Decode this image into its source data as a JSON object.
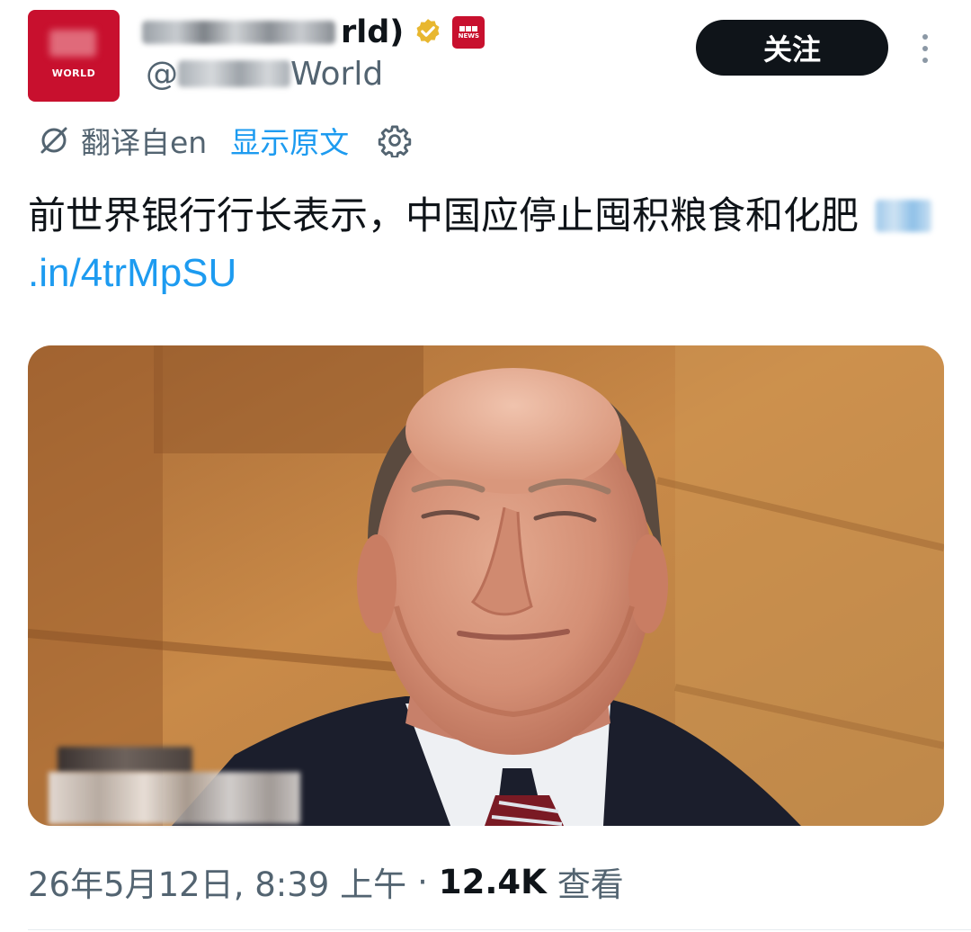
{
  "account": {
    "display_name": "rld)",
    "handle": "@",
    "handle_suffix": "World",
    "avatar_label": "WORLD",
    "affiliate_badge": "NEWS",
    "verified": true
  },
  "header": {
    "follow_label": "关注"
  },
  "translation": {
    "label": "翻译自en",
    "show_original_label": "显示原文"
  },
  "tweet": {
    "text": "前世界银行行长表示，中国应停止囤积粮食和化肥",
    "link_text": ".in/4trMpSU"
  },
  "media": {
    "alt": "news-photo"
  },
  "meta": {
    "timestamp": "26年5月12日, 8:39 上午",
    "separator": "·",
    "views_count": "12.4K",
    "views_label": "查看"
  },
  "colors": {
    "brand_red": "#c8102e",
    "link_blue": "#1d9bf0",
    "muted_gray": "#536471",
    "text_dark": "#0f1419",
    "verified_gold": "#e8b72f"
  }
}
